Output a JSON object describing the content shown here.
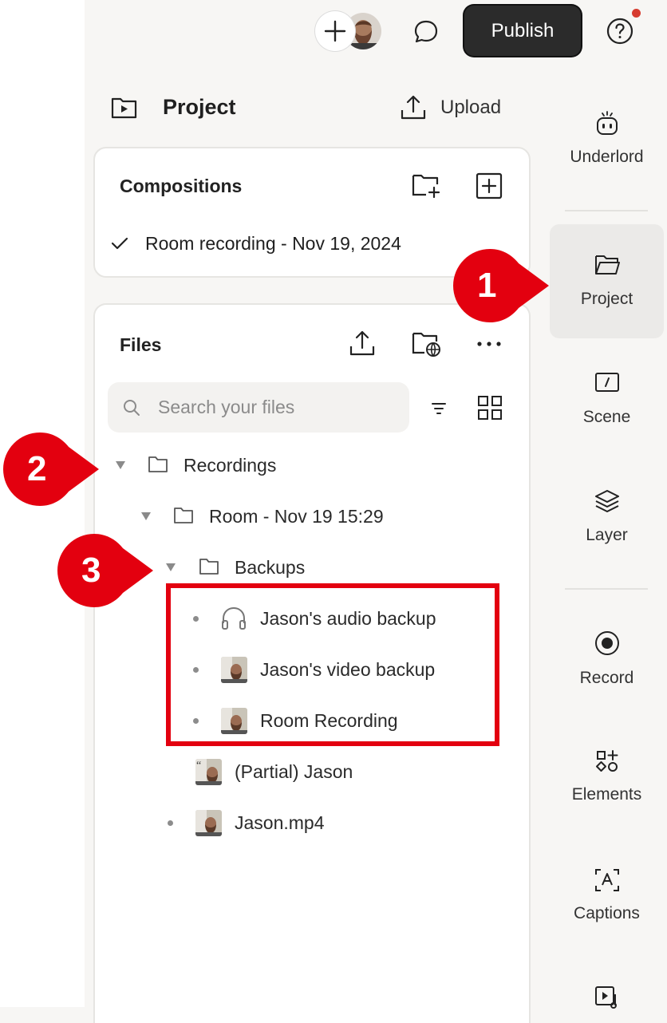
{
  "header": {
    "publish_label": "Publish"
  },
  "project": {
    "title": "Project",
    "upload_label": "Upload"
  },
  "compositions": {
    "title": "Compositions",
    "items": [
      {
        "label": "Room recording - Nov 19, 2024",
        "selected": true
      }
    ]
  },
  "files": {
    "title": "Files",
    "search_placeholder": "Search your files",
    "tree": {
      "recordings": "Recordings",
      "room": "Room - Nov 19 15:29",
      "backups": "Backups",
      "audio_backup": "Jason's audio backup",
      "video_backup": "Jason's video backup",
      "room_recording": "Room Recording",
      "partial": "(Partial) Jason",
      "mp4": "Jason.mp4"
    }
  },
  "rail": {
    "underlord": "Underlord",
    "project": "Project",
    "scene": "Scene",
    "layer": "Layer",
    "record": "Record",
    "elements": "Elements",
    "captions": "Captions"
  },
  "callouts": [
    "1",
    "2",
    "3"
  ],
  "colors": {
    "callout_red": "#e3000f",
    "publish_bg": "#2b2b2b",
    "notification": "#d63b2f"
  }
}
